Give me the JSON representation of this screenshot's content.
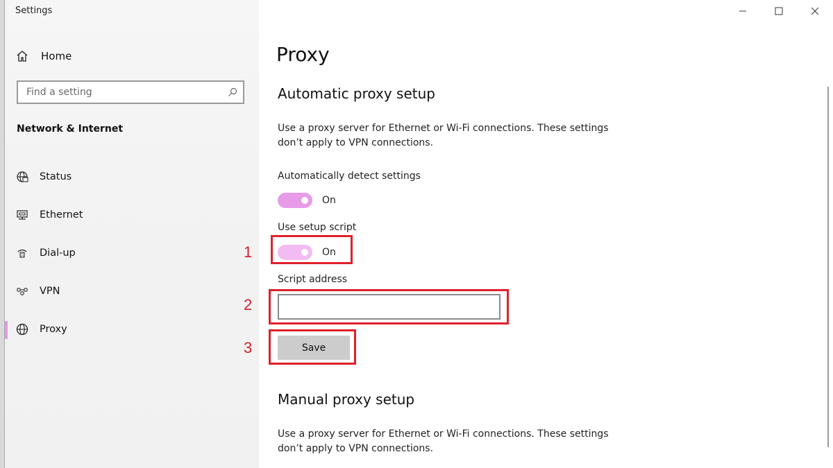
{
  "window": {
    "title": "Settings",
    "controls": [
      "minimize-icon",
      "maximize-icon",
      "close-icon"
    ]
  },
  "sidebar": {
    "home_label": "Home",
    "search_placeholder": "Find a setting",
    "section_title": "Network & Internet",
    "items": [
      {
        "label": "Status",
        "icon": "status-globe-icon"
      },
      {
        "label": "Ethernet",
        "icon": "ethernet-icon"
      },
      {
        "label": "Dial-up",
        "icon": "dialup-icon"
      },
      {
        "label": "VPN",
        "icon": "vpn-icon"
      },
      {
        "label": "Proxy",
        "icon": "proxy-globe-icon",
        "selected": true
      }
    ]
  },
  "main": {
    "page_title": "Proxy",
    "automatic": {
      "heading": "Automatic proxy setup",
      "description": "Use a proxy server for Ethernet or Wi-Fi connections. These settings don’t apply to VPN connections.",
      "auto_detect_label": "Automatically detect settings",
      "auto_detect_state": "On",
      "setup_script_label": "Use setup script",
      "setup_script_state": "On",
      "script_address_label": "Script address",
      "script_address_value": "",
      "save_label": "Save"
    },
    "manual": {
      "heading": "Manual proxy setup",
      "description": "Use a proxy server for Ethernet or Wi-Fi connections. These settings don’t apply to VPN connections."
    }
  },
  "annotations": {
    "n1": "1",
    "n2": "2",
    "n3": "3",
    "color": "#e0202a"
  },
  "colors": {
    "toggle_on": "#e89be9",
    "toggle_on_dim": "#f2bcf2",
    "accent_bar": "#e29ae2"
  }
}
